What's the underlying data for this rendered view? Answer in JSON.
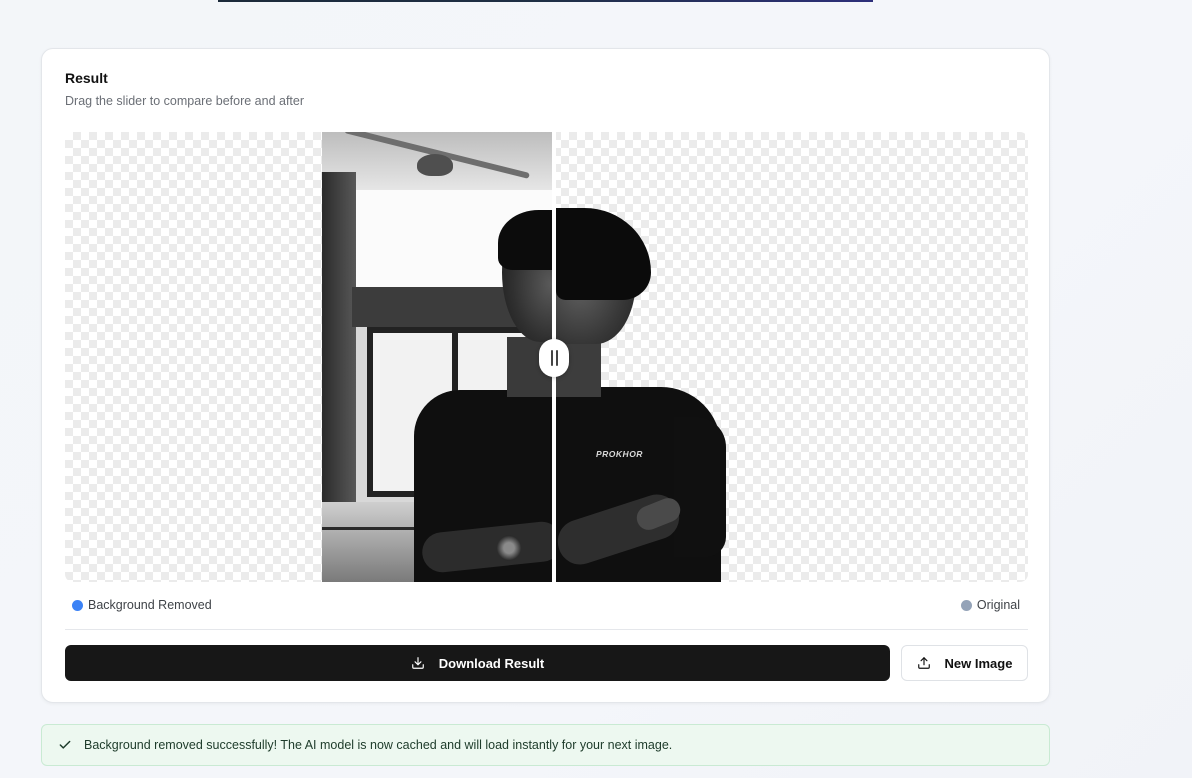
{
  "card": {
    "title": "Result",
    "subtitle": "Drag the slider to compare before and after"
  },
  "compare": {
    "slider_position_percent": 51,
    "shirt_text": "PROKHOR",
    "left_label": "Background Removed",
    "right_label": "Original",
    "left_dot_color": "#3b82f6",
    "right_dot_color": "#94a3b8"
  },
  "actions": {
    "download_label": "Download Result",
    "download_icon": "download-icon",
    "new_image_label": "New Image",
    "new_image_icon": "upload-icon"
  },
  "toast": {
    "icon": "check-icon",
    "message": "Background removed successfully! The AI model is now cached and will load instantly for your next image."
  }
}
